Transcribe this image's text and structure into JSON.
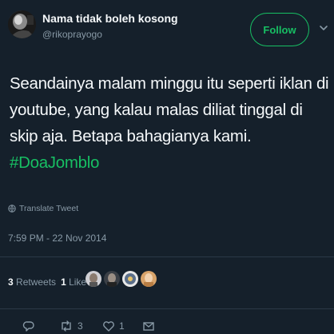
{
  "user": {
    "display_name": "Nama tidak boleh kosong",
    "handle": "@rikoprayogo",
    "avatar_icon": "avatar-photo"
  },
  "follow_button": {
    "label": "Follow"
  },
  "tweet": {
    "lines": [
      "Seandainya malam minggu itu seperti iklan di",
      "youtube, yang kalau malas diliat tinggal di",
      "skip aja. Betapa bahagianya kami."
    ],
    "hashtag": "#DoaJomblo",
    "translate_label": "Translate Tweet",
    "timestamp": "7:59 PM - 22 Nov 2014"
  },
  "stats": {
    "retweets_count": "3",
    "retweets_label": "Retweets",
    "likes_count": "1",
    "likes_label": "Like"
  },
  "actions": {
    "reply_icon": "reply-icon",
    "retweet_count": "3",
    "like_count": "1"
  },
  "colors": {
    "background": "#15202b",
    "accent": "#17bf63",
    "muted": "#8899a6",
    "text": "#f5f8fa"
  }
}
